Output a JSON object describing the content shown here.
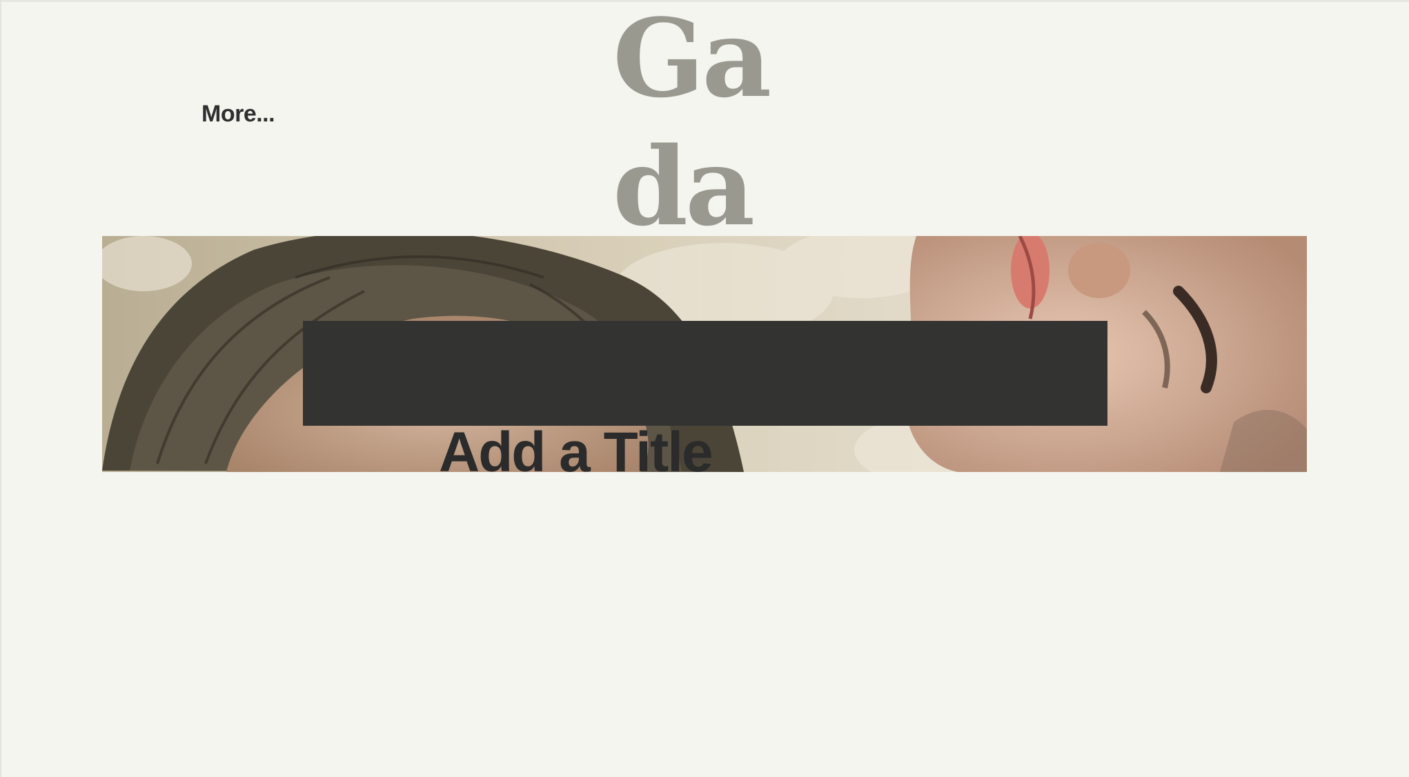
{
  "header": {
    "site_title": "Gada",
    "more_label": "More..."
  },
  "hero": {
    "image_icon": "portrait-photo",
    "title": "Add a Title",
    "overlay_color": "#333332"
  },
  "colors": {
    "background": "#f5f5f0",
    "site_title": "#999990",
    "text_dark": "#2f2f2f"
  }
}
